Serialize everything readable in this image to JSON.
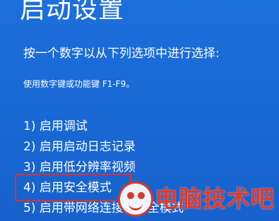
{
  "screen": {
    "title": "启动设置",
    "prompt": "按一个数字以从下列选项中进行选择:",
    "hint": "使用数字键或功能键 F1-F9。",
    "options": [
      "1) 启用调试",
      "2) 启用启动日志记录",
      "3) 启用低分辨率视频",
      "4) 启用安全模式",
      "5) 启用带网络连接的安全模式"
    ],
    "highlighted_option": "4) 启用安全模式"
  },
  "watermark": {
    "text": "电脑技术吧",
    "logo_icon": "smiley-logo-icon"
  },
  "colors": {
    "background": "#1a6ad6",
    "text": "#ffffff",
    "highlight_border": "#e0302a",
    "watermark_red": "#e03a2a"
  }
}
